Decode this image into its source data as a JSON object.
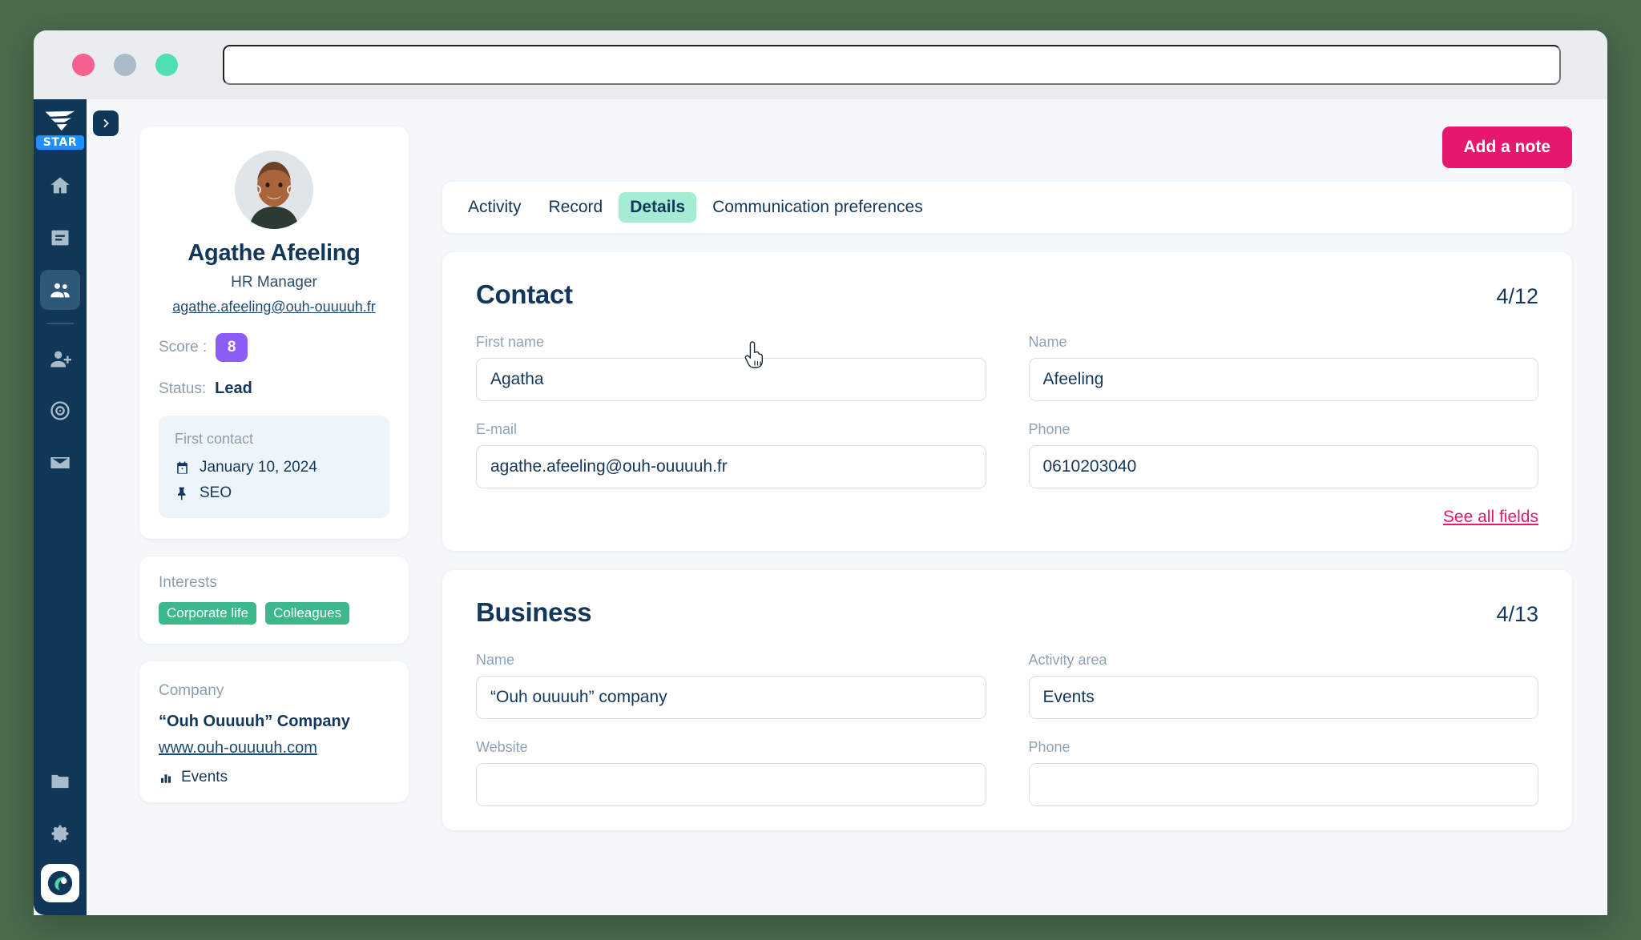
{
  "window": {
    "traffic_lights": [
      "close",
      "minimize",
      "maximize"
    ],
    "url_value": "",
    "url_placeholder": ""
  },
  "sidebar": {
    "brand": {
      "logo_icon": "tornado-logo-icon",
      "badge": "STAR"
    },
    "collapse_icon": "chevron-right-icon",
    "items": [
      {
        "icon": "home-icon",
        "name": "home",
        "active": false
      },
      {
        "icon": "book-icon",
        "name": "library",
        "active": false
      },
      {
        "icon": "people-icon",
        "name": "contacts",
        "active": true
      },
      {
        "icon": "add-person-icon",
        "name": "add-contact",
        "active": false
      },
      {
        "icon": "target-icon",
        "name": "campaigns",
        "active": false
      },
      {
        "icon": "envelope-icon",
        "name": "messages",
        "active": false
      }
    ],
    "bottom_items": [
      {
        "icon": "folder-icon",
        "name": "files"
      },
      {
        "icon": "gear-icon",
        "name": "settings"
      },
      {
        "icon": "user-avatar-icon",
        "name": "account"
      }
    ]
  },
  "profile": {
    "avatar_alt": "Agathe Afeeling portrait",
    "name": "Agathe Afeeling",
    "role": "HR Manager",
    "email": "agathe.afeeling@ouh-ouuuuh.fr",
    "score_label": "Score :",
    "score_value": "8",
    "status_label": "Status:",
    "status_value": "Lead",
    "first_contact": {
      "title": "First contact",
      "date_icon": "calendar-icon",
      "date": "January 10, 2024",
      "source_icon": "pin-icon",
      "source": "SEO"
    }
  },
  "interests": {
    "title": "Interests",
    "tags": [
      "Corporate life",
      "Colleagues"
    ]
  },
  "company": {
    "title": "Company",
    "name": "“Ouh Ouuuuh” Company",
    "website": "www.ouh-ouuuuh.com",
    "tag_icon": "chart-icon",
    "tag": "Events"
  },
  "toolbar": {
    "add_note_label": "Add a note"
  },
  "tabs": [
    {
      "label": "Activity",
      "active": false
    },
    {
      "label": "Record",
      "active": false
    },
    {
      "label": "Details",
      "active": true
    },
    {
      "label": "Communication preferences",
      "active": false
    }
  ],
  "sections": [
    {
      "title": "Contact",
      "count": "4/12",
      "fields": [
        {
          "label": "First name",
          "value": "Agatha",
          "placeholder": ""
        },
        {
          "label": "Name",
          "value": "Afeeling",
          "placeholder": ""
        },
        {
          "label": "E-mail",
          "value": "agathe.afeeling@ouh-ouuuuh.fr",
          "placeholder": ""
        },
        {
          "label": "Phone",
          "value": "0610203040",
          "placeholder": ""
        }
      ],
      "see_all_label": "See all fields"
    },
    {
      "title": "Business",
      "count": "4/13",
      "fields": [
        {
          "label": "Name",
          "value": "“Ouh ouuuuh” company",
          "placeholder": ""
        },
        {
          "label": "Activity area",
          "value": "Events",
          "placeholder": ""
        },
        {
          "label": "Website",
          "value": "",
          "placeholder": ""
        },
        {
          "label": "Phone",
          "value": "",
          "placeholder": ""
        }
      ],
      "see_all_label": ""
    }
  ],
  "colors": {
    "sidebar": "#103758",
    "accent_pink": "#e5176f",
    "accent_mint": "#a5ecd5",
    "tag_green": "#3cb98a",
    "score_purple": "#8b5cf6",
    "page_bg": "#f4f8fa"
  },
  "cursor": {
    "icon": "pointing-hand-cursor"
  }
}
